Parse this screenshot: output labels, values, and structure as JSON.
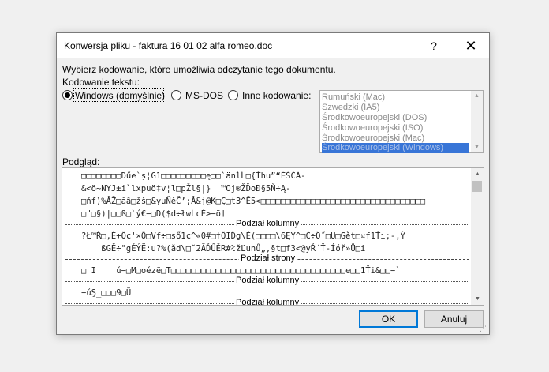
{
  "window": {
    "title": "Konwersja pliku - faktura 16 01 02  alfa romeo.doc",
    "help_glyph": "?",
    "close_glyph": "✕"
  },
  "instructions": "Wybierz kodowanie, które umożliwia odczytanie tego dokumentu.",
  "encoding": {
    "group_label": "Kodowanie tekstu:",
    "options": [
      {
        "label": "Windows (domyślnie)",
        "checked": true
      },
      {
        "label": "MS-DOS",
        "checked": false
      },
      {
        "label": "Inne kodowanie:",
        "checked": false
      }
    ],
    "list": [
      "Rumuński (Mac)",
      "Szwedzki (IA5)",
      "Środkowoeuropejski (DOS)",
      "Środkowoeuropejski (ISO)",
      "Środkowoeuropejski (Mac)",
      "Środkowoeuropejski (Windows)"
    ],
    "selected_index": 5
  },
  "preview": {
    "label": "Podgląd:",
    "lines": [
      "□□□□□□□□Dűe`ş¦G1□□□□□□□□□ę□□`änĺĹ□{Ťhu”“ĔŠČĂ-",
      "&<ö~NYJ±i`lxpuö‡v¦l□pŽl§|}  ™Oj®ŽĎoĐ§5Ň÷Ą-",
      "□ňf)%ÂŽ□ăâ□žš□&yuŇěČ’;Â&j@K□Ç□t3^Ě5<□□□□□□□□□□□□□□□□□□□□□□□□□□□□□□□□□",
      "□\"□§)|□□ß□`ý€−□D($d÷łwĹcÉ>−ö†",
      "?Ł™Ř□,É+Öc'×Ő□Vf÷□ső1c^«0#□†ÖIĎg\\Ě(□□□□\\6ĘÝ^□Ć÷Ô˝□U□Gět□¤f1Ťi;-‚Ý",
      "    ßGĚ÷\"gÉÝË:u?%(ăd\\□˘2ĂĎŰĚR#łžĽunů„,§t□f3<@yŘ´Ť-Íóř»Ů□i",
      "□ I    ú−□M□oézë□T□□□□□□□□□□□□□□□□□□□□□□□□□□□□□□□□□□□e□□1Ťi&□□−`",
      "−úŞ_□□□9□Ü"
    ],
    "sep_column": "Podział kolumny",
    "sep_page": "Podział strony"
  },
  "buttons": {
    "ok": "OK",
    "cancel": "Anuluj"
  }
}
